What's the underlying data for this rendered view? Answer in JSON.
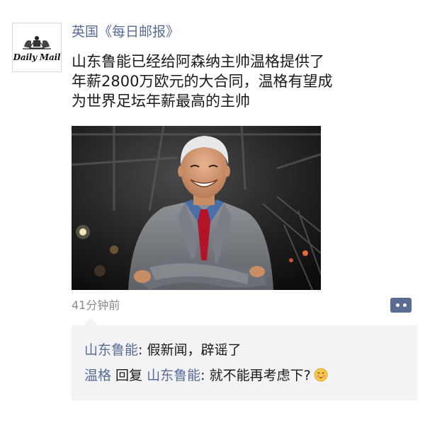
{
  "post": {
    "author": "英国《每日邮报》",
    "avatar": {
      "logo_text": "Daily Mail",
      "icon": "daily-mail-crest"
    },
    "text_lines": [
      "山东鲁能已经给阿森纳主帅温格提供了",
      "年薪2800万欧元的大合同，温格有望成",
      "为世界足坛年薪最高的主帅"
    ],
    "image": {
      "description_icon": "smiling-man-in-grey-suit-photo"
    },
    "time": "41分钟前",
    "more_icon": "comment-more-icon"
  },
  "comments": [
    {
      "user": "山东鲁能",
      "separator": ": ",
      "text": "假新闻，辟谣了"
    },
    {
      "user": "温格",
      "reply_word": " 回复 ",
      "reply_to": "山东鲁能",
      "separator": ": ",
      "text": "就不能再考虑下?",
      "emoji": "smiling-blush-emoji"
    }
  ],
  "colors": {
    "link": "#576b95",
    "comment_bg": "#f3f3f5",
    "text": "#1a1a1a",
    "time": "#8a8a8a"
  }
}
